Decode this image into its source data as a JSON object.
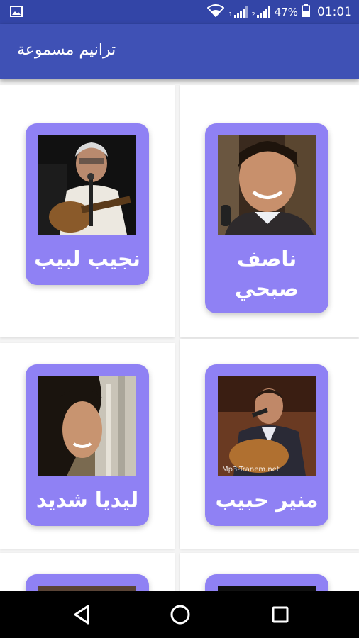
{
  "status_bar": {
    "battery": "47%",
    "time": "01:01",
    "sim1": "1",
    "sim2": "2"
  },
  "app_bar": {
    "title": "ترانيم مسموعة"
  },
  "singers": [
    {
      "name": "ناصف صبحي",
      "photo_icon": "portrait-photo"
    },
    {
      "name": "نجيب لبيب",
      "photo_icon": "portrait-photo"
    },
    {
      "name": "منير حبيب",
      "photo_icon": "portrait-photo",
      "watermark": "Mp3-Tranem.net"
    },
    {
      "name": "ليديا شديد",
      "photo_icon": "portrait-photo"
    }
  ],
  "colors": {
    "status_bar": "#3345a7",
    "app_bar": "#3f51b5",
    "card": "#8f81f4",
    "nav_bar": "#000000"
  },
  "nav": {
    "back_icon": "back-triangle-icon",
    "home_icon": "home-circle-icon",
    "recents_icon": "recents-square-icon"
  }
}
